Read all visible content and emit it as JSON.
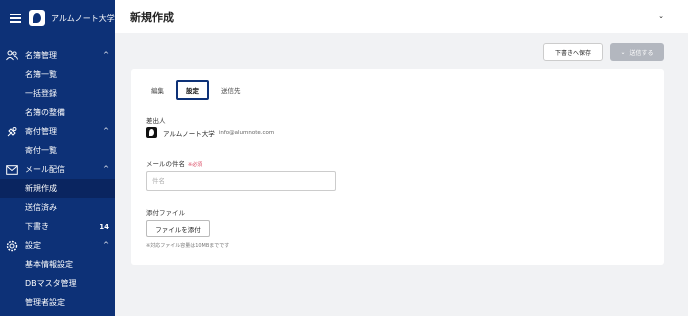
{
  "sidebar": {
    "org_name": "アルムノート大学",
    "sections": [
      {
        "label": "名簿管理",
        "icon": "people-icon",
        "items": [
          "名簿一覧",
          "一括登録",
          "名簿の整備"
        ]
      },
      {
        "label": "寄付管理",
        "icon": "donation-icon",
        "items": [
          "寄付一覧"
        ]
      },
      {
        "label": "メール配信",
        "icon": "mail-icon",
        "items": [
          "新規作成",
          "送信済み",
          "下書き"
        ],
        "active_item": "新規作成",
        "drafts_count": "14"
      },
      {
        "label": "設定",
        "icon": "gear-icon",
        "items": [
          "基本情報設定",
          "DBマスタ管理",
          "管理者設定"
        ]
      }
    ]
  },
  "header": {
    "title": "新規作成"
  },
  "actions": {
    "draft_label": "下書きへ保存",
    "send_label": "送信する"
  },
  "tabs": [
    "編集",
    "設定",
    "送信先"
  ],
  "active_tab": "設定",
  "form": {
    "sender_label": "差出人",
    "sender_name": "アルムノート大学",
    "sender_email": "info@alumnote.com",
    "subject_label": "メールの件名",
    "required_label": "※必須",
    "subject_placeholder": "件名",
    "attachment_label": "添付ファイル",
    "attach_button": "ファイルを添付",
    "attachment_note": "※対応ファイル容量は10MBまでです"
  },
  "colors": {
    "sidebar": "#0d3177",
    "required": "#d9455f",
    "disabled_button": "#b3b7bf"
  }
}
